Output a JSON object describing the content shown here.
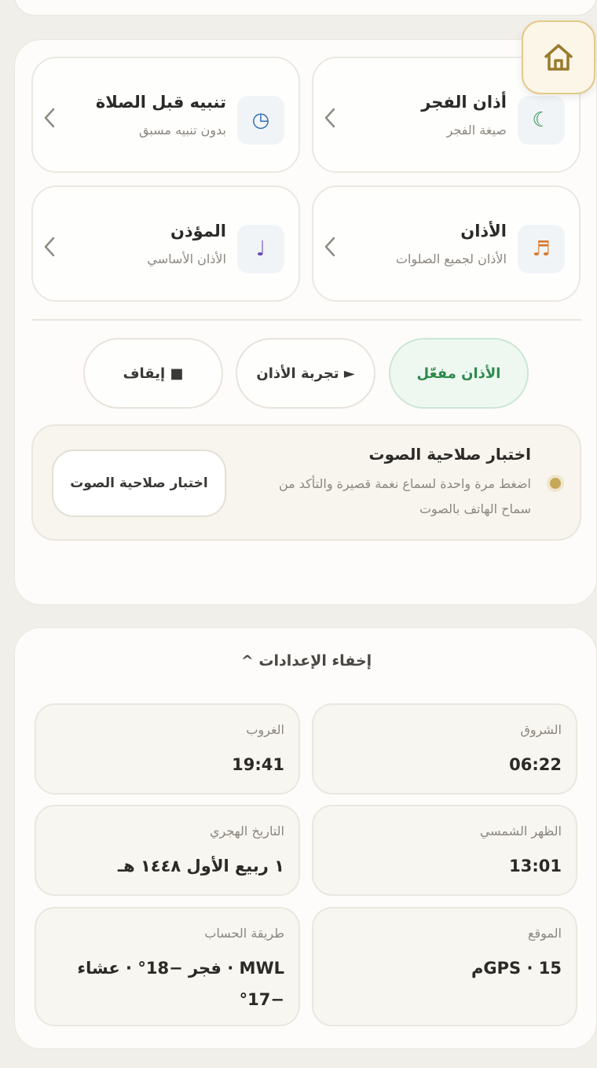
{
  "tiles": [
    {
      "title": "أذان الفجر",
      "subtitle": "صيغة الفجر",
      "icon": "crescent-moon-icon",
      "icon_glyph": "☾",
      "icon_color": "#2e8a4c"
    },
    {
      "title": "تنبيه قبل الصلاة",
      "subtitle": "بدون تنبيه مسبق",
      "icon": "clock-icon",
      "icon_glyph": "◷",
      "icon_color": "#2f6fb3"
    },
    {
      "title": "الأذان",
      "subtitle": "الأذان لجميع الصلوات",
      "icon": "music-notes-icon",
      "icon_glyph": "♬",
      "icon_color": "#d9792b"
    },
    {
      "title": "المؤذن",
      "subtitle": "الأذان الأساسي",
      "icon": "music-note-icon",
      "icon_glyph": "♩",
      "icon_color": "#6a4bb0"
    }
  ],
  "controls": {
    "adhan_enabled": "الأذان مفعّل",
    "test_adhan": "► تجربة الأذان",
    "stop": "■ إيقاف"
  },
  "sound_check": {
    "title": "اختبار صلاحية الصوت",
    "description": "اضغط مرة واحدة لسماع نغمة قصيرة والتأكد من سماح الهاتف بالصوت",
    "button": "اختبار صلاحية الصوت"
  },
  "settings_toggle": "إخفاء الإعدادات ^",
  "info": [
    {
      "label": "الشروق",
      "value": "06:22"
    },
    {
      "label": "الغروب",
      "value": "19:41"
    },
    {
      "label": "الظهر الشمسي",
      "value": "13:01"
    },
    {
      "label": "التاريخ الهجري",
      "value": "١ ربيع الأول ١٤٤٨ هـ"
    },
    {
      "label": "الموقع",
      "value": "GPS · 15م"
    },
    {
      "label": "طريقة الحساب",
      "value": "MWL · فجر −18° · عشاء −17°"
    }
  ],
  "colors": {
    "accent_gold": "#c7a85a",
    "enabled_green": "#2e8a4c",
    "background": "#f1efe9"
  }
}
